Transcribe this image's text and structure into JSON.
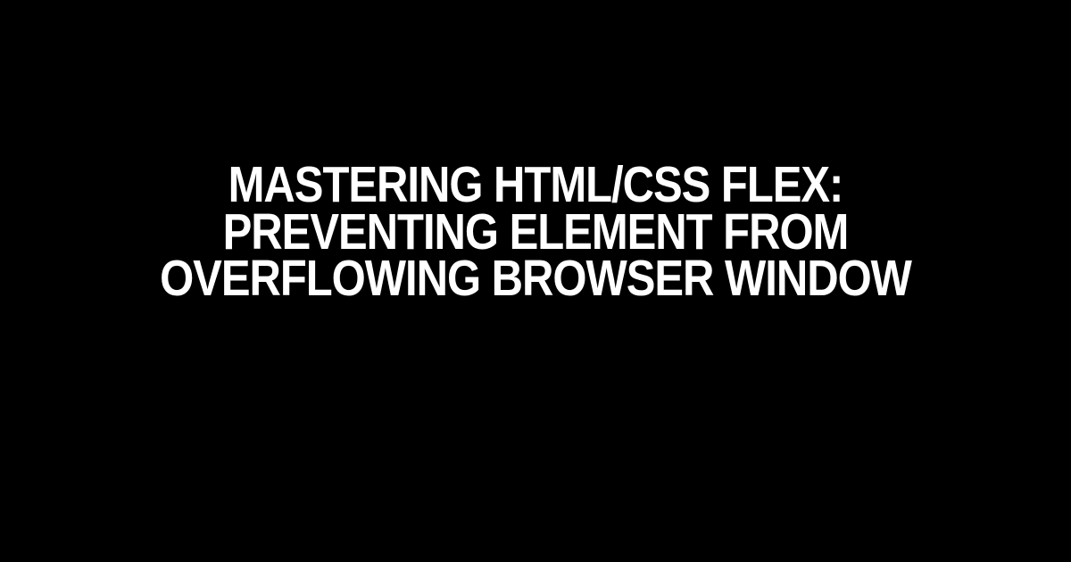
{
  "title": "Mastering HTML/CSS Flex: Preventing Element from Overflowing Browser Window"
}
